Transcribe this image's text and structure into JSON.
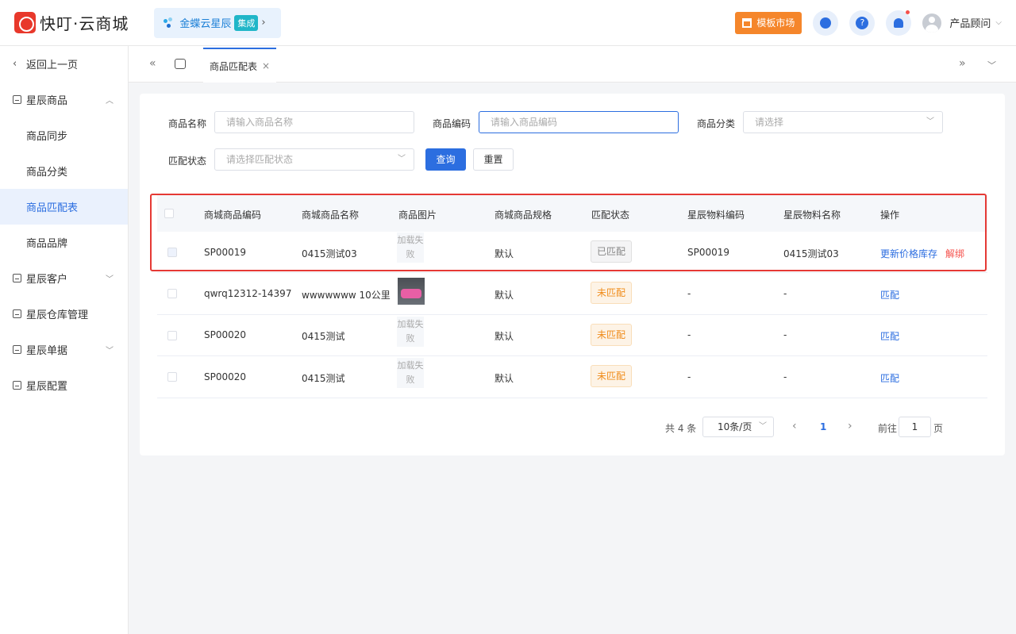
{
  "header": {
    "logo_text": "快叮·云商城",
    "integration_name": "金蝶云星辰",
    "integration_badge": "集成",
    "market_button": "模板市场",
    "user_name": "产品顾问"
  },
  "sidebar": {
    "back_label": "返回上一页",
    "items": [
      {
        "label": "星辰商品"
      },
      {
        "label": "商品同步"
      },
      {
        "label": "商品分类"
      },
      {
        "label": "商品匹配表"
      },
      {
        "label": "商品品牌"
      },
      {
        "label": "星辰客户"
      },
      {
        "label": "星辰仓库管理"
      },
      {
        "label": "星辰单据"
      },
      {
        "label": "星辰配置"
      }
    ]
  },
  "tabs": {
    "active_label": "商品匹配表"
  },
  "filters": {
    "name_label": "商品名称",
    "name_placeholder": "请输入商品名称",
    "code_label": "商品编码",
    "code_placeholder": "请输入商品编码",
    "category_label": "商品分类",
    "category_placeholder": "请选择",
    "status_label": "匹配状态",
    "status_placeholder": "请选择匹配状态",
    "query_button": "查询",
    "reset_button": "重置"
  },
  "table": {
    "headers": [
      "商城商品编码",
      "商城商品名称",
      "商品图片",
      "商城商品规格",
      "匹配状态",
      "星辰物料编码",
      "星辰物料名称",
      "操作"
    ],
    "img_fail_text": "加载失败",
    "rows": [
      {
        "code": "SP00019",
        "name": "0415测试03",
        "image": "加载失败",
        "spec": "默认",
        "status": "已匹配",
        "mat_code": "SP00019",
        "mat_name": "0415测试03",
        "action1": "更新价格库存",
        "action2": "解绑"
      },
      {
        "code": "qwrq12312-14397",
        "name": "wwwwwww 10公里",
        "image": "",
        "spec": "默认",
        "status": "未匹配",
        "mat_code": "-",
        "mat_name": "-",
        "action1": "匹配"
      },
      {
        "code": "SP00020",
        "name": "0415测试",
        "image": "加载失败",
        "spec": "默认",
        "status": "未匹配",
        "mat_code": "-",
        "mat_name": "-",
        "action1": "匹配"
      },
      {
        "code": "SP00020",
        "name": "0415测试",
        "image": "加载失败",
        "spec": "默认",
        "status": "未匹配",
        "mat_code": "-",
        "mat_name": "-",
        "action1": "匹配"
      }
    ]
  },
  "pagination": {
    "total_text": "共 4 条",
    "page_size": "10条/页",
    "current_page": "1",
    "goto_label": "前往",
    "goto_value": "1",
    "page_unit": "页"
  }
}
